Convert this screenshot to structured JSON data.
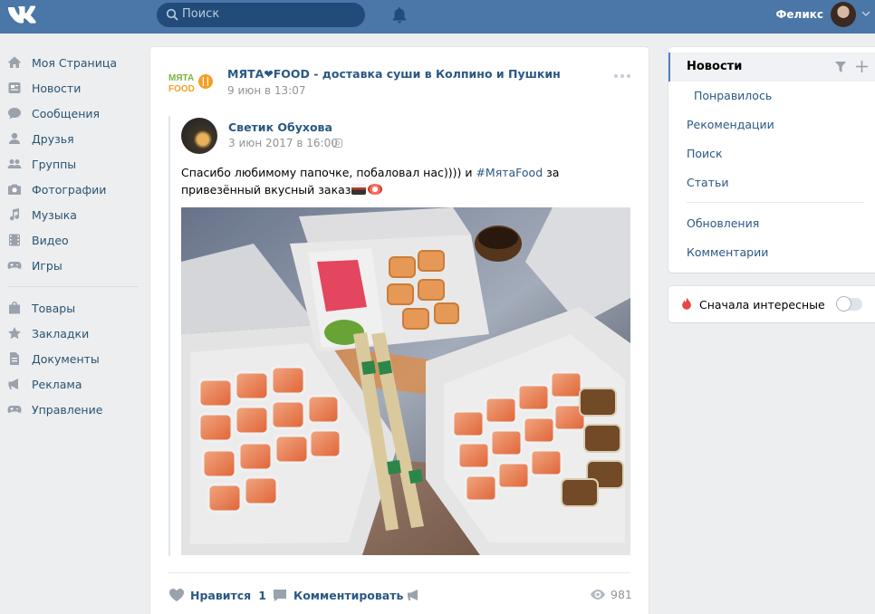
{
  "header": {
    "search_placeholder": "Поиск",
    "username": "Феликс"
  },
  "leftnav": {
    "items": [
      {
        "label": "Моя Страница",
        "icon": "home-icon"
      },
      {
        "label": "Новости",
        "icon": "news-icon"
      },
      {
        "label": "Сообщения",
        "icon": "messages-icon"
      },
      {
        "label": "Друзья",
        "icon": "friends-icon"
      },
      {
        "label": "Группы",
        "icon": "groups-icon"
      },
      {
        "label": "Фотографии",
        "icon": "camera-icon"
      },
      {
        "label": "Музыка",
        "icon": "music-note-icon"
      },
      {
        "label": "Видео",
        "icon": "film-icon"
      },
      {
        "label": "Игры",
        "icon": "gamepad-icon"
      }
    ],
    "items2": [
      {
        "label": "Товары",
        "icon": "bag-icon"
      },
      {
        "label": "Закладки",
        "icon": "star-icon"
      },
      {
        "label": "Документы",
        "icon": "document-icon"
      },
      {
        "label": "Реклама",
        "icon": "megaphone-icon"
      },
      {
        "label": "Управление",
        "icon": "gamepad-icon"
      }
    ]
  },
  "post": {
    "group_logo_text": "МЯТА FOOD",
    "group_title": "МЯТА❤FOOD - доставка суши в Колпино и Пушкин",
    "date": "9 июн в 13:07",
    "repost": {
      "author": "Светик Обухова",
      "date": "3 июн 2017 в 16:00",
      "text_before": "Спасибо любимому папочке, побаловал нас)))) и ",
      "hashtag": "#МятаFood",
      "text_after": " за привезённый вкусный заказ"
    },
    "actions": {
      "like_label": "Нравится",
      "like_count": "1",
      "comment_label": "Комментировать",
      "views": "981"
    }
  },
  "rightnav": {
    "active": "Новости",
    "items": [
      "Понравилось",
      "Рекомендации",
      "Поиск",
      "Статьи",
      "Обновления",
      "Комментарии"
    ]
  },
  "interesting_box": {
    "label": "Сначала интересные",
    "toggle_on": false
  },
  "colors": {
    "header": "#4a76a8",
    "link": "#2a5885",
    "accent": "#5181b8",
    "fire": "#e64646",
    "brand_green": "#7cb342"
  }
}
